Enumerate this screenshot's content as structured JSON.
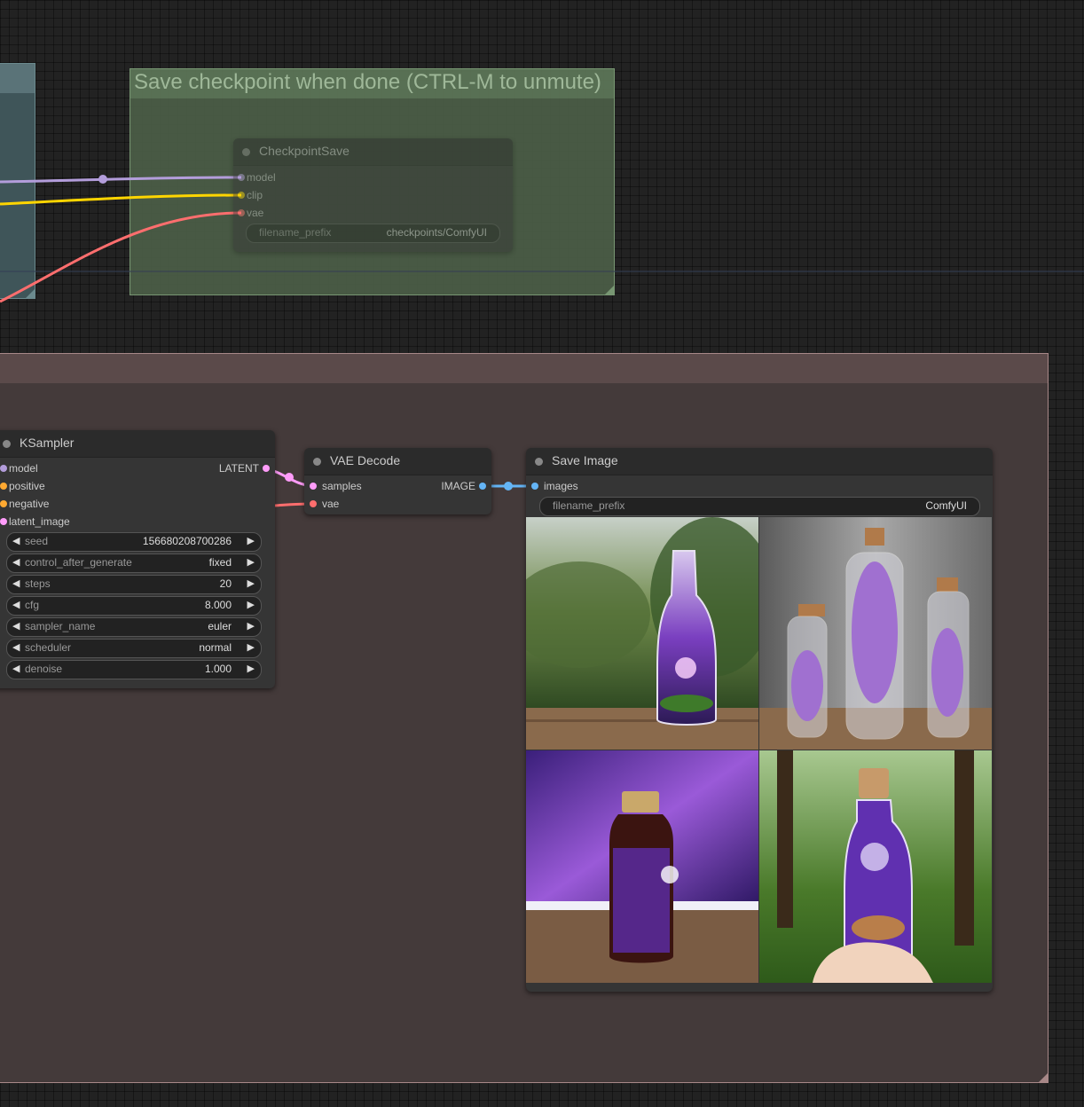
{
  "group_checkpoint": {
    "title": "Save checkpoint when done (CTRL-M to unmute)"
  },
  "checkpoint_save": {
    "title": "CheckpointSave",
    "inputs": [
      "model",
      "clip",
      "vae"
    ],
    "widget": {
      "label": "filename_prefix",
      "value": "checkpoints/ComfyUI"
    }
  },
  "ksampler": {
    "title": "KSampler",
    "inputs": [
      "model",
      "positive",
      "negative",
      "latent_image"
    ],
    "output": "LATENT",
    "widgets": [
      {
        "label": "seed",
        "value": "156680208700286"
      },
      {
        "label": "control_after_generate",
        "value": "fixed"
      },
      {
        "label": "steps",
        "value": "20"
      },
      {
        "label": "cfg",
        "value": "8.000"
      },
      {
        "label": "sampler_name",
        "value": "euler"
      },
      {
        "label": "scheduler",
        "value": "normal"
      },
      {
        "label": "denoise",
        "value": "1.000"
      }
    ]
  },
  "vae_decode": {
    "title": "VAE Decode",
    "inputs": [
      "samples",
      "vae"
    ],
    "output": "IMAGE"
  },
  "save_image": {
    "title": "Save Image",
    "input": "images",
    "widget": {
      "label": "filename_prefix",
      "value": "ComfyUI"
    }
  },
  "colors": {
    "model": "#b39ddb",
    "clip": "#ffd500",
    "vae": "#ff6e6e",
    "latent": "#ff9cf9",
    "image": "#64b5f6",
    "conditioning": "#ffa931"
  },
  "arrows": {
    "left": "◀",
    "right": "▶"
  }
}
